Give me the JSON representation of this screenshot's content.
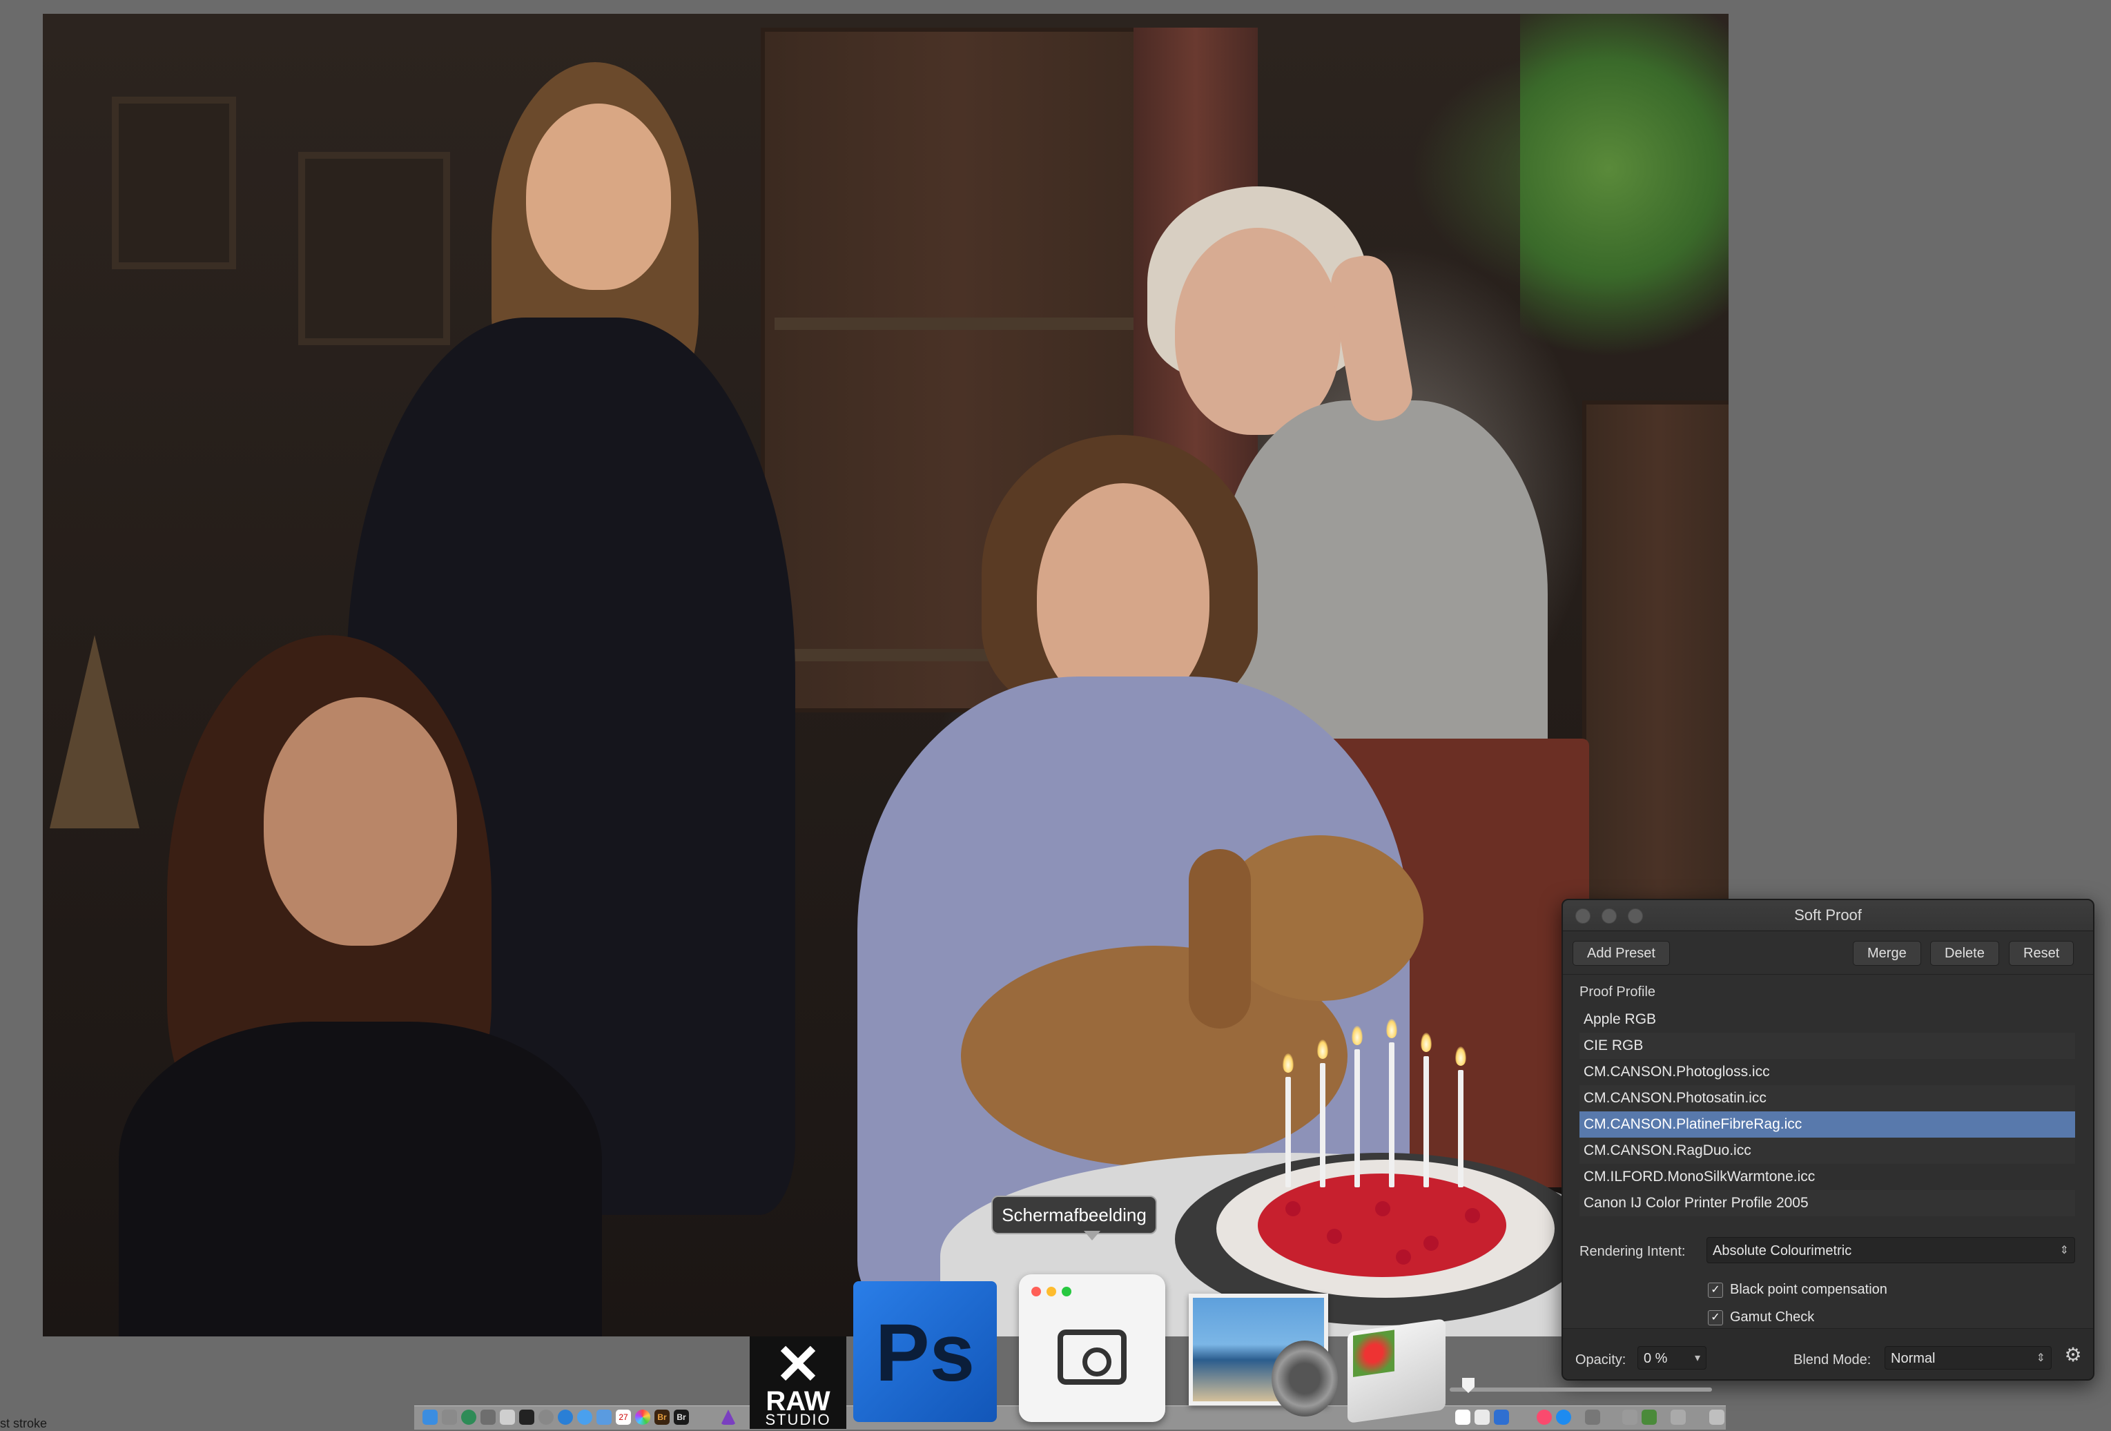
{
  "panel": {
    "title": "Soft Proof",
    "buttons": {
      "add_preset": "Add Preset",
      "merge": "Merge",
      "delete": "Delete",
      "reset": "Reset"
    },
    "proof_profile_label": "Proof Profile",
    "profiles": [
      "Apple RGB",
      "CIE RGB",
      "CM.CANSON.Photogloss.icc",
      "CM.CANSON.Photosatin.icc",
      "CM.CANSON.PlatineFibreRag.icc",
      "CM.CANSON.RagDuo.icc",
      "CM.ILFORD.MonoSilkWarmtone.icc",
      "Canon IJ Color Printer Profile 2005"
    ],
    "selected_profile": "CM.CANSON.PlatineFibreRag.icc",
    "rendering_intent_label": "Rendering Intent:",
    "rendering_intent_value": "Absolute Colourimetric",
    "black_point_label": "Black point compensation",
    "black_point_checked": true,
    "gamut_check_label": "Gamut Check",
    "gamut_check_checked": true,
    "opacity_label": "Opacity:",
    "opacity_value": "0 %",
    "blend_mode_label": "Blend Mode:",
    "blend_mode_value": "Normal"
  },
  "dock": {
    "tooltip": "Schermafbeelding",
    "raw_studio_text": "RAW",
    "raw_studio_sub": "STUDIO",
    "ps_text": "Ps",
    "br_text": "Br",
    "calendar_day": "27"
  },
  "status_text": "st stroke",
  "colors": {
    "selection": "#5879ac",
    "panel_bg": "#2f2f2f",
    "ps_blue": "#1f6fd6"
  }
}
